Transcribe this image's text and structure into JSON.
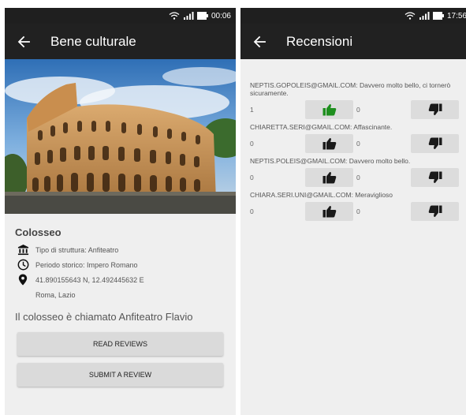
{
  "left": {
    "status": {
      "time": "00:06"
    },
    "appbar": {
      "title": "Bene culturale"
    },
    "place": {
      "name": "Colosseo",
      "type": "Tipo di struttura: Anfiteatro",
      "period": "Periodo storico: Impero Romano",
      "coords": "41.890155643 N, 12.492445632 E",
      "location": "Roma, Lazio",
      "description": "Il colosseo è chiamato Anfiteatro Flavio"
    },
    "buttons": {
      "read": "READ REVIEWS",
      "submit": "SUBMIT A REVIEW"
    }
  },
  "right": {
    "status": {
      "time": "17:56"
    },
    "appbar": {
      "title": "Recensioni"
    },
    "reviews": [
      {
        "text": "NEPTIS.GOPOLEIS@GMAIL.COM: Davvero molto bello, ci tornerò sicuramente.",
        "likes": "1",
        "dislikes": "0",
        "liked": true
      },
      {
        "text": "CHIARETTA.SERI@GMAIL.COM: Affascinante.",
        "likes": "0",
        "dislikes": "0",
        "liked": false
      },
      {
        "text": "NEPTIS.POLEIS@GMAIL.COM: Davvero molto bello.",
        "likes": "0",
        "dislikes": "0",
        "liked": false
      },
      {
        "text": "CHIARA.SERI.UNI@GMAIL.COM: Meraviglioso",
        "likes": "0",
        "dislikes": "0",
        "liked": false
      }
    ]
  },
  "icons": {
    "back": "arrow-back-icon",
    "type": "bank-icon",
    "period": "clock-icon",
    "coords": "location-pin-icon",
    "like": "thumb-up-icon",
    "dislike": "thumb-down-icon"
  },
  "colors": {
    "appbar": "#212121",
    "statusbar": "#1f1f1f",
    "background": "#efefef",
    "button": "#dadada",
    "like_active": "#1e8f1e",
    "icon_default": "#1a1a1a"
  }
}
